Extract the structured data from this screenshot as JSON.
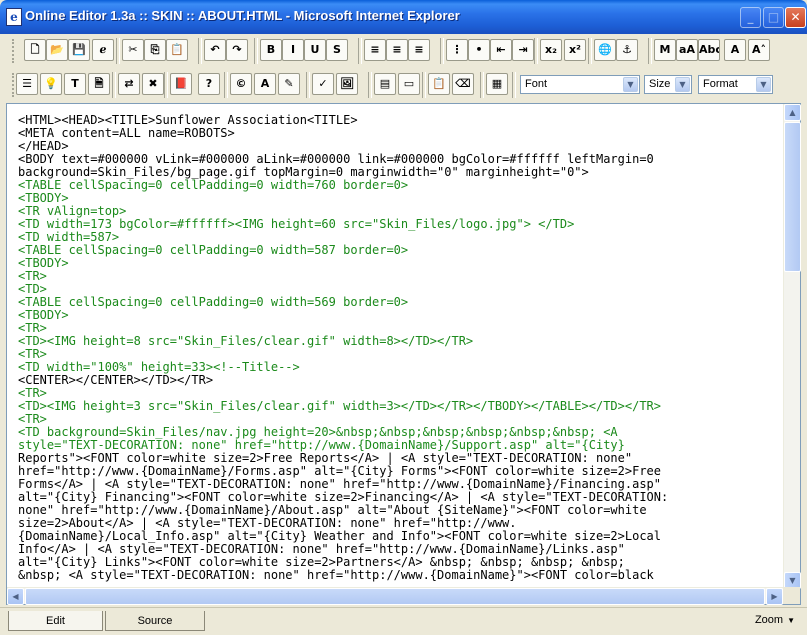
{
  "window": {
    "title": "Online Editor 1.3a :: SKIN :: ABOUT.HTML - Microsoft Internet Explorer",
    "icon": "ie-document-icon",
    "minimize": "_",
    "maximize": "□",
    "close": "✕"
  },
  "toolbar1": [
    {
      "name": "new-document-button",
      "glyph": "🗋"
    },
    {
      "name": "open-folder-button",
      "glyph": "📂"
    },
    {
      "name": "save-button",
      "glyph": "💾"
    },
    {
      "name": "preview-browser-button",
      "glyph": "ℯ"
    },
    {
      "name": "cut-button",
      "glyph": "✂"
    },
    {
      "name": "copy-button",
      "glyph": "⎘"
    },
    {
      "name": "paste-button",
      "glyph": "📋"
    },
    {
      "name": "undo-button",
      "glyph": "↶"
    },
    {
      "name": "redo-button",
      "glyph": "↷"
    },
    {
      "name": "bold-button",
      "glyph": "B"
    },
    {
      "name": "italic-button",
      "glyph": "I"
    },
    {
      "name": "underline-button",
      "glyph": "U"
    },
    {
      "name": "strikethrough-button",
      "glyph": "S"
    },
    {
      "name": "align-left-button",
      "glyph": "≡"
    },
    {
      "name": "align-center-button",
      "glyph": "≡"
    },
    {
      "name": "align-right-button",
      "glyph": "≡"
    },
    {
      "name": "ordered-list-button",
      "glyph": "⋮"
    },
    {
      "name": "unordered-list-button",
      "glyph": "•"
    },
    {
      "name": "outdent-button",
      "glyph": "⇤"
    },
    {
      "name": "indent-button",
      "glyph": "⇥"
    },
    {
      "name": "subscript-button",
      "glyph": "x₂"
    },
    {
      "name": "superscript-button",
      "glyph": "x²"
    },
    {
      "name": "hyperlink-button",
      "glyph": "🌐"
    },
    {
      "name": "anchor-button",
      "glyph": "⚓"
    },
    {
      "name": "marquee-button",
      "glyph": "M"
    },
    {
      "name": "text-case-button",
      "glyph": "aA"
    },
    {
      "name": "abc-button",
      "glyph": "Abc"
    },
    {
      "name": "font-size-up-button",
      "glyph": "A"
    },
    {
      "name": "font-size-down-button",
      "glyph": "A˄"
    }
  ],
  "toolbar2": [
    {
      "name": "properties-button",
      "glyph": "☰"
    },
    {
      "name": "highlight-button",
      "glyph": "💡"
    },
    {
      "name": "text-box-button",
      "glyph": "T"
    },
    {
      "name": "page-properties-button",
      "glyph": "🗎"
    },
    {
      "name": "toggle-mode-button",
      "glyph": "⇄"
    },
    {
      "name": "stop-button",
      "glyph": "✖"
    },
    {
      "name": "special-chars-button",
      "glyph": "📕"
    },
    {
      "name": "help-button",
      "glyph": "?"
    },
    {
      "name": "copyright-button",
      "glyph": "©"
    },
    {
      "name": "font-color-button",
      "glyph": "A"
    },
    {
      "name": "background-color-button",
      "glyph": "✎"
    },
    {
      "name": "spellcheck-button",
      "glyph": "✓"
    },
    {
      "name": "insert-image-button",
      "glyph": "🖼"
    },
    {
      "name": "insert-table-button",
      "glyph": "▤"
    },
    {
      "name": "insert-form-button",
      "glyph": "▭"
    },
    {
      "name": "paste-special-button",
      "glyph": "📋"
    },
    {
      "name": "cleanup-button",
      "glyph": "⌫"
    },
    {
      "name": "image-gallery-button",
      "glyph": "▦"
    }
  ],
  "selects": {
    "font": "Font",
    "size": "Size",
    "format": "Format"
  },
  "code_lines": [
    {
      "t": "<HTML><HEAD><TITLE>Sunflower Association<TITLE>",
      "c": "k"
    },
    {
      "t": "<META content=ALL name=ROBOTS>",
      "c": "k"
    },
    {
      "t": "</HEAD>",
      "c": "k"
    },
    {
      "t": "<BODY text=#000000 vLink=#000000 aLink=#000000 link=#000000 bgColor=#ffffff leftMargin=0",
      "c": "k"
    },
    {
      "t": "background=Skin_Files/bg_page.gif topMargin=0 marginwidth=\"0\" marginheight=\"0\">",
      "c": "k"
    },
    {
      "t": "<TABLE cellSpacing=0 cellPadding=0 width=760 border=0>",
      "c": "g"
    },
    {
      "t": "<TBODY>",
      "c": "g"
    },
    {
      "t": "<TR vAlign=top>",
      "c": "g"
    },
    {
      "t": "<TD width=173 bgColor=#ffffff><IMG height=60 src=\"Skin_Files/logo.jpg\"> </TD>",
      "c": "g"
    },
    {
      "t": "<TD width=587>",
      "c": "g"
    },
    {
      "t": "<TABLE cellSpacing=0 cellPadding=0 width=587 border=0>",
      "c": "g"
    },
    {
      "t": "<TBODY>",
      "c": "g"
    },
    {
      "t": "<TR>",
      "c": "g"
    },
    {
      "t": "<TD>",
      "c": "g"
    },
    {
      "t": "<TABLE cellSpacing=0 cellPadding=0 width=569 border=0>",
      "c": "g"
    },
    {
      "t": "<TBODY>",
      "c": "g"
    },
    {
      "t": "<TR>",
      "c": "g"
    },
    {
      "t": "<TD><IMG height=8 src=\"Skin_Files/clear.gif\" width=8></TD></TR>",
      "c": "g"
    },
    {
      "t": "<TR>",
      "c": "g"
    },
    {
      "t": "<TD width=\"100%\" height=33><!--Title-->",
      "c": "g"
    },
    {
      "t": "<CENTER></CENTER></TD></TR>",
      "c": "k"
    },
    {
      "t": "<TR>",
      "c": "g"
    },
    {
      "t": "<TD><IMG height=3 src=\"Skin_Files/clear.gif\" width=3></TD></TR></TBODY></TABLE></TD></TR>",
      "c": "g"
    },
    {
      "t": "<TR>",
      "c": "g"
    },
    {
      "t": "<TD background=Skin_Files/nav.jpg height=20>&nbsp;&nbsp;&nbsp;&nbsp;&nbsp;&nbsp; <A",
      "c": "g"
    },
    {
      "t": "style=\"TEXT-DECORATION: none\" href=\"http://www.{DomainName}/Support.asp\" alt=\"{City}",
      "c": "g"
    },
    {
      "t": "Reports\"><FONT color=white size=2>Free Reports</A> | <A style=\"TEXT-DECORATION: none\"",
      "c": "k"
    },
    {
      "t": "href=\"http://www.{DomainName}/Forms.asp\" alt=\"{City} Forms\"><FONT color=white size=2>Free",
      "c": "k"
    },
    {
      "t": "Forms</A> | <A style=\"TEXT-DECORATION: none\" href=\"http://www.{DomainName}/Financing.asp\"",
      "c": "k"
    },
    {
      "t": "alt=\"{City} Financing\"><FONT color=white size=2>Financing</A> | <A style=\"TEXT-DECORATION:",
      "c": "k"
    },
    {
      "t": "none\" href=\"http://www.{DomainName}/About.asp\" alt=\"About {SiteName}\"><FONT color=white",
      "c": "k"
    },
    {
      "t": "size=2>About</A> | <A style=\"TEXT-DECORATION: none\" href=\"http://www.",
      "c": "k"
    },
    {
      "t": "{DomainName}/Local_Info.asp\" alt=\"{City} Weather and Info\"><FONT color=white size=2>Local",
      "c": "k"
    },
    {
      "t": "Info</A> | <A style=\"TEXT-DECORATION: none\" href=\"http://www.{DomainName}/Links.asp\"",
      "c": "k"
    },
    {
      "t": "alt=\"{City} Links\"><FONT color=white size=2>Partners</A> &nbsp; &nbsp; &nbsp; &nbsp;",
      "c": "k"
    },
    {
      "t": "&nbsp; <A style=\"TEXT-DECORATION: none\" href=\"http://www.{DomainName}\"><FONT color=black",
      "c": "k"
    }
  ],
  "tabs": {
    "edit": "Edit",
    "source": "Source"
  },
  "zoom": {
    "label": "Zoom"
  },
  "colors": {
    "title_bar": "#2a72e8",
    "code_tag": "#1b8a1b",
    "code_text": "#000000"
  }
}
